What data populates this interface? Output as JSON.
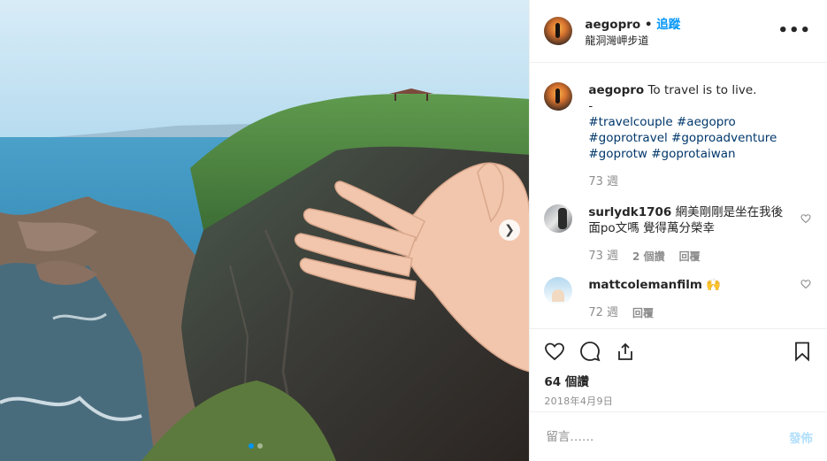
{
  "header": {
    "username": "aegopro",
    "separator": "•",
    "follow_label": "追蹤",
    "location": "龍洞灣岬步道",
    "more_icon": "more-options-icon"
  },
  "caption": {
    "username": "aegopro",
    "text": "To travel is to live.",
    "dash": "-",
    "hashtags": [
      "#travelcouple #aegopro",
      "#goprotravel #goproadventure",
      "#goprotw #goprotaiwan"
    ],
    "time": "73 週"
  },
  "comments": [
    {
      "username": "surlydk1706",
      "text": "網美剛剛是坐在我後面po文嗎 覺得萬分榮幸",
      "time": "73 週",
      "likes": "2 個讚",
      "reply": "回覆"
    },
    {
      "username": "mattcolemanfilm",
      "text": "🙌",
      "time": "72 週",
      "reply": "回覆"
    }
  ],
  "stats": {
    "views": "64 個讚",
    "date": "2018年4月9日"
  },
  "comment_box": {
    "placeholder": "留言……",
    "post_label": "發佈"
  },
  "carousel": {
    "slides": 2,
    "active_index": 0
  },
  "colors": {
    "accent": "#0095f6",
    "hashtag": "#00376b",
    "muted": "#8e8e8e"
  }
}
